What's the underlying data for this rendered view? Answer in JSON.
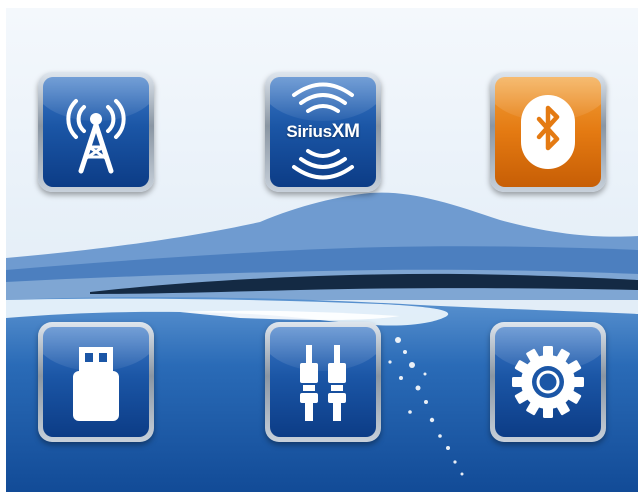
{
  "menu": {
    "items": [
      {
        "id": "radio",
        "icon": "radio-tower-icon",
        "style": "blue"
      },
      {
        "id": "siriusxm",
        "icon": "siriusxm-logo-icon",
        "style": "blue",
        "logo_main": "Sirius",
        "logo_suffix": "XM"
      },
      {
        "id": "bluetooth",
        "icon": "bluetooth-icon",
        "style": "orange"
      },
      {
        "id": "usb",
        "icon": "usb-drive-icon",
        "style": "blue"
      },
      {
        "id": "aux",
        "icon": "rca-plug-icon",
        "style": "blue"
      },
      {
        "id": "settings",
        "icon": "gear-icon",
        "style": "blue"
      }
    ]
  },
  "colors": {
    "tile_blue": "#1b56a6",
    "tile_orange": "#e47a12",
    "sky": "#e6f0f8",
    "mountain": "#4a7ebd",
    "water": "#1f5fae"
  }
}
